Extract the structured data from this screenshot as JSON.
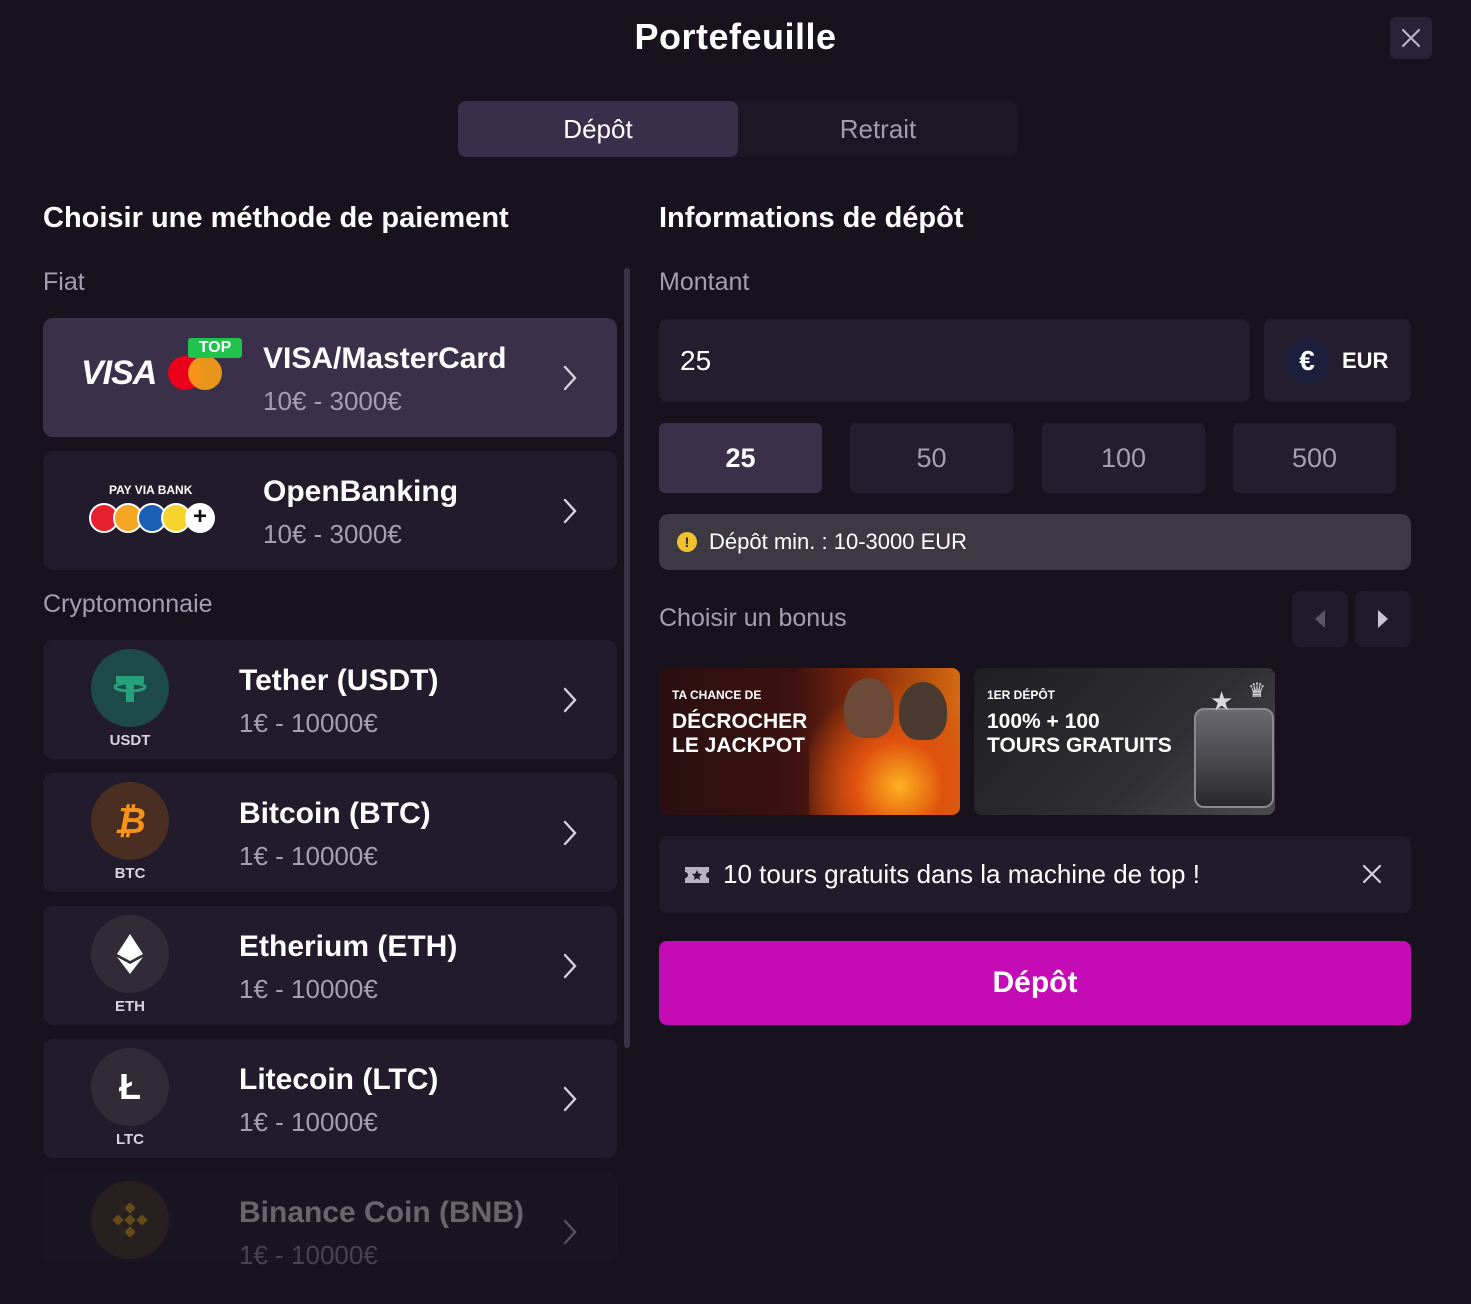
{
  "modal": {
    "title": "Portefeuille"
  },
  "tabs": {
    "deposit": "Dépôt",
    "withdraw": "Retrait",
    "active": "deposit"
  },
  "left": {
    "heading": "Choisir une méthode de paiement",
    "fiat_label": "Fiat",
    "crypto_label": "Cryptomonnaie",
    "fiat_methods": [
      {
        "name": "VISA/MasterCard",
        "range": "10€ - 3000€",
        "logo_text": "VISA",
        "badge": "TOP",
        "icon": "visa-mastercard-logo"
      },
      {
        "name": "OpenBanking",
        "range": "10€ - 3000€",
        "logo_text": "PAY VIA BANK",
        "icon": "bank-logos"
      }
    ],
    "crypto_methods": [
      {
        "name": "Tether (USDT)",
        "range": "1€ - 10000€",
        "symbol": "USDT",
        "color": "#1e4a4a",
        "fg": "#26a17b",
        "icon": "tether-icon"
      },
      {
        "name": "Bitcoin (BTC)",
        "range": "1€ - 10000€",
        "symbol": "BTC",
        "color": "#4a2e22",
        "fg": "#f7931a",
        "icon": "bitcoin-icon"
      },
      {
        "name": "Etherium (ETH)",
        "range": "1€ - 10000€",
        "symbol": "ETH",
        "color": "#2f2c37",
        "fg": "#ffffff",
        "icon": "ethereum-icon"
      },
      {
        "name": "Litecoin (LTC)",
        "range": "1€ - 10000€",
        "symbol": "LTC",
        "color": "#2f2c37",
        "fg": "#ffffff",
        "icon": "litecoin-icon"
      },
      {
        "name": "Binance Coin (BNB)",
        "range": "1€ - 10000€",
        "symbol": "BNB",
        "color": "#4a3a22",
        "fg": "#f0b90b",
        "icon": "binance-icon"
      }
    ]
  },
  "right": {
    "heading": "Informations de dépôt",
    "amount_label": "Montant",
    "amount_value": "25",
    "currency": "EUR",
    "currency_symbol": "€",
    "presets": [
      "25",
      "50",
      "100",
      "500"
    ],
    "active_preset": "25",
    "min_info": "Dépôt min. : 10-3000 EUR",
    "bonus_label": "Choisir un bonus",
    "bonuses": [
      {
        "small": "TA CHANCE DE",
        "big_line1": "DÉCROCHER",
        "big_line2": "LE JACKPOT"
      },
      {
        "small": "1ER DÉPÔT",
        "big_line1": "100% + 100",
        "big_line2": "TOURS GRATUITS"
      }
    ],
    "bonus_description": "10 tours gratuits dans la machine de top !",
    "deposit_button": "Dépôt"
  },
  "colors": {
    "background": "#17121e",
    "card": "#221b2c",
    "card_selected": "#3a3049",
    "accent": "#c50bb6"
  }
}
